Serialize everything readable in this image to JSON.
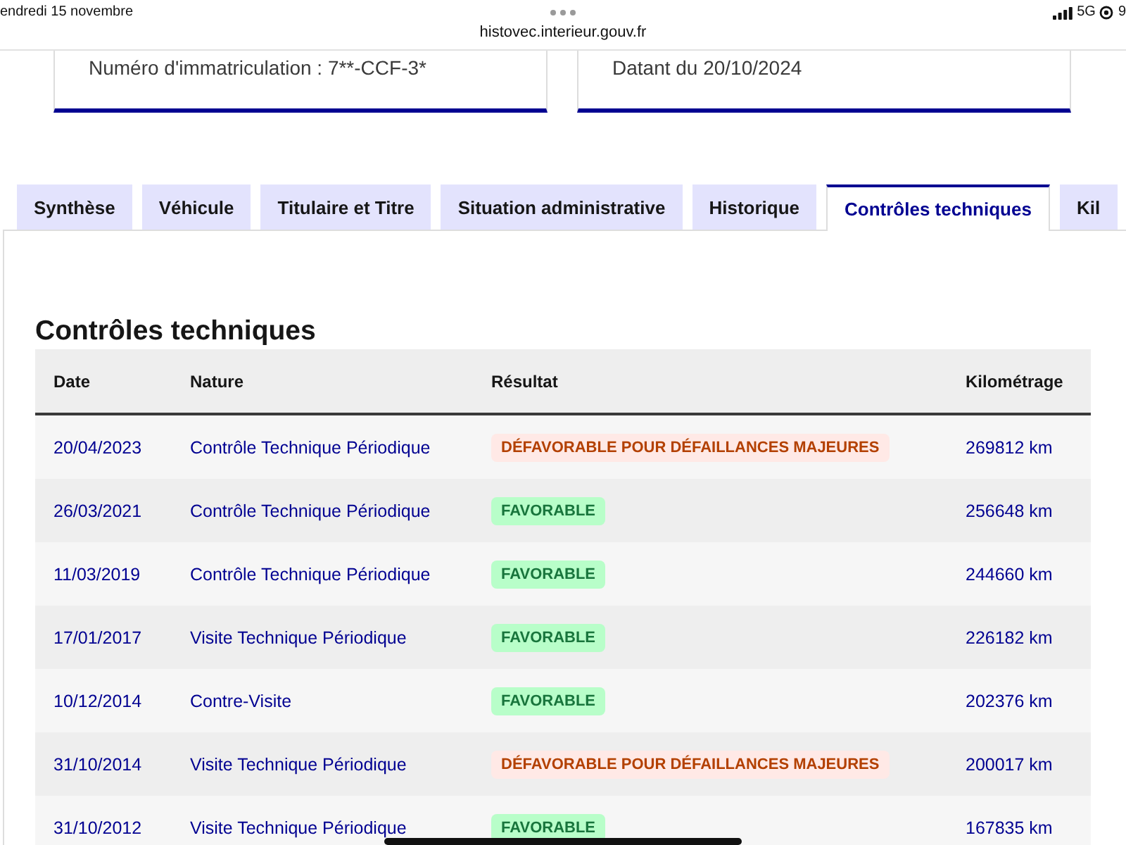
{
  "status_bar": {
    "date": "endredi 15 novembre",
    "url": "histovec.interieur.gouv.fr",
    "network": "5G",
    "battery": "9"
  },
  "summary_cards": [
    "Numéro d'immatriculation : 7**-CCF-3*",
    "Datant du 20/10/2024"
  ],
  "tabs": [
    {
      "label": "Synthèse",
      "selected": false
    },
    {
      "label": "Véhicule",
      "selected": false
    },
    {
      "label": "Titulaire et Titre",
      "selected": false
    },
    {
      "label": "Situation administrative",
      "selected": false
    },
    {
      "label": "Historique",
      "selected": false
    },
    {
      "label": "Contrôles techniques",
      "selected": true
    },
    {
      "label": "Kil",
      "selected": false
    }
  ],
  "section": {
    "title": "Contrôles techniques",
    "table": {
      "columns": [
        "Date",
        "Nature",
        "Résultat",
        "Kilométrage"
      ],
      "rows": [
        {
          "date": "20/04/2023",
          "nature": "Contrôle Technique Périodique",
          "result": {
            "label": "DÉFAVORABLE POUR DÉFAILLANCES MAJEURES",
            "kind": "unfavorable"
          },
          "mileage": "269812 km"
        },
        {
          "date": "26/03/2021",
          "nature": "Contrôle Technique Périodique",
          "result": {
            "label": "FAVORABLE",
            "kind": "favorable"
          },
          "mileage": "256648 km"
        },
        {
          "date": "11/03/2019",
          "nature": "Contrôle Technique Périodique",
          "result": {
            "label": "FAVORABLE",
            "kind": "favorable"
          },
          "mileage": "244660 km"
        },
        {
          "date": "17/01/2017",
          "nature": "Visite Technique Périodique",
          "result": {
            "label": "FAVORABLE",
            "kind": "favorable"
          },
          "mileage": "226182 km"
        },
        {
          "date": "10/12/2014",
          "nature": "Contre-Visite",
          "result": {
            "label": "FAVORABLE",
            "kind": "favorable"
          },
          "mileage": "202376 km"
        },
        {
          "date": "31/10/2014",
          "nature": "Visite Technique Périodique",
          "result": {
            "label": "DÉFAVORABLE POUR DÉFAILLANCES MAJEURES",
            "kind": "unfavorable"
          },
          "mileage": "200017 km"
        },
        {
          "date": "31/10/2012",
          "nature": "Visite Technique Périodique",
          "result": {
            "label": "FAVORABLE",
            "kind": "favorable"
          },
          "mileage": "167835 km"
        }
      ]
    }
  }
}
